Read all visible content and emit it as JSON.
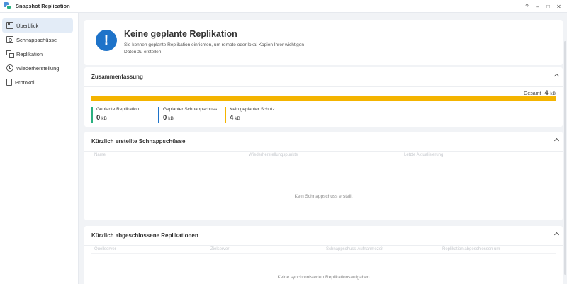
{
  "window": {
    "title": "Snapshot Replication",
    "help": "?",
    "minimize": "–",
    "maximize": "□",
    "close": "✕"
  },
  "sidebar": {
    "items": [
      {
        "label": "Überblick",
        "icon": "overview-icon"
      },
      {
        "label": "Schnappschüsse",
        "icon": "snapshot-icon"
      },
      {
        "label": "Replikation",
        "icon": "replication-icon"
      },
      {
        "label": "Wiederherstellung",
        "icon": "restore-icon"
      },
      {
        "label": "Protokoll",
        "icon": "log-icon"
      }
    ]
  },
  "alert": {
    "icon": "!",
    "title": "Keine geplante Replikation",
    "text": "Sie konnen geplante Replikation einrichten, um remote oder lokal Kopien Ihrer wichtigen Daten zu erstellen."
  },
  "summary": {
    "title": "Zusammenfassung",
    "total_label": "Gesamt",
    "total_value": "4",
    "total_unit": "kB",
    "bar_fill_fraction": 1.0,
    "colors": {
      "replication": "#2ab07f",
      "snapshot": "#1e73c9",
      "unprotected": "#f4b400"
    },
    "stats": [
      {
        "label": "Geplante Replikation",
        "value": "0",
        "unit": "kB"
      },
      {
        "label": "Geplanter Schnappschuss",
        "value": "0",
        "unit": "kB"
      },
      {
        "label": "Kein geplanter Schutz",
        "value": "4",
        "unit": "kB"
      }
    ]
  },
  "recent_snapshots": {
    "title": "Kürzlich erstellte Schnappschüsse",
    "columns": [
      "Name",
      "Wiederherstellungspunkte",
      "Letzte Aktualisierung"
    ],
    "empty": "Kein Schnappschuss erstellt"
  },
  "recent_replications": {
    "title": "Kürzlich abgeschlossene Replikationen",
    "columns": [
      "Quellserver",
      "Zielserver",
      "Schnappschuss-Aufnahmezeit",
      "Replikation abgeschlossen um"
    ],
    "empty": "Keine synchronisierten Replikationsaufgaben"
  }
}
